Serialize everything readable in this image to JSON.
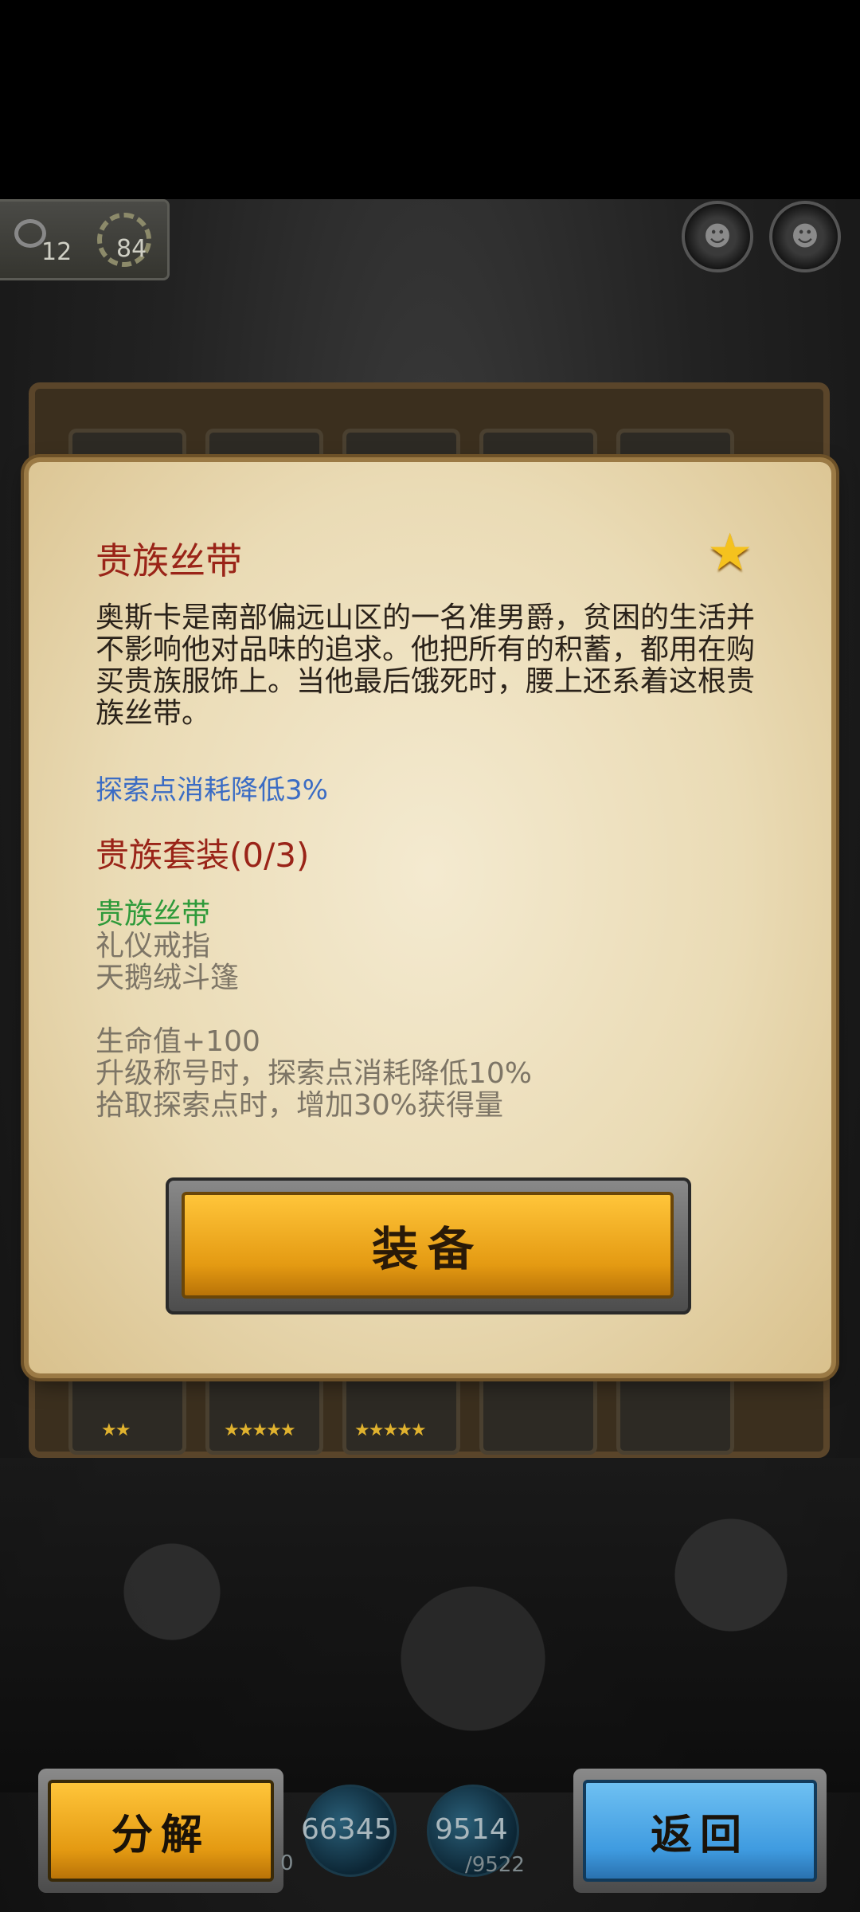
{
  "hud": {
    "resource_a": "12",
    "resource_b": "84",
    "round_btn_icons": [
      "monster-face-icon",
      "monster-face-icon"
    ]
  },
  "inventory_stars": [
    "★★",
    "★★★★★",
    "★★★★★"
  ],
  "item": {
    "name": "贵族丝带",
    "rarity_icon": "star-icon",
    "description": "奥斯卡是南部偏远山区的一名准男爵，贫困的生活并不影响他对品味的追求。他把所有的积蓄，都用在购买贵族服饰上。当他最后饿死时，腰上还系着这根贵族丝带。",
    "effect": "探索点消耗降低3%",
    "set_title": "贵族套装(0/3)",
    "set_items": [
      "贵族丝带",
      "礼仪戒指",
      "天鹅绒斗篷"
    ],
    "set_bonuses": [
      "生命值+100",
      "升级称号时，探索点消耗降低10%",
      "拾取探索点时，增加30%获得量"
    ],
    "equip_label": "装备"
  },
  "bottom": {
    "dismantle_label": "分解",
    "back_label": "返回",
    "gold_value": "66345",
    "gold_partial": "0",
    "explore_value": "9514",
    "explore_max": "/9522"
  },
  "colors": {
    "title_red": "#9a2418",
    "effect_blue": "#3b6cc4",
    "set_active_green": "#2e9a3a",
    "button_gold": "#f0a81e",
    "button_blue": "#3f9be0"
  }
}
